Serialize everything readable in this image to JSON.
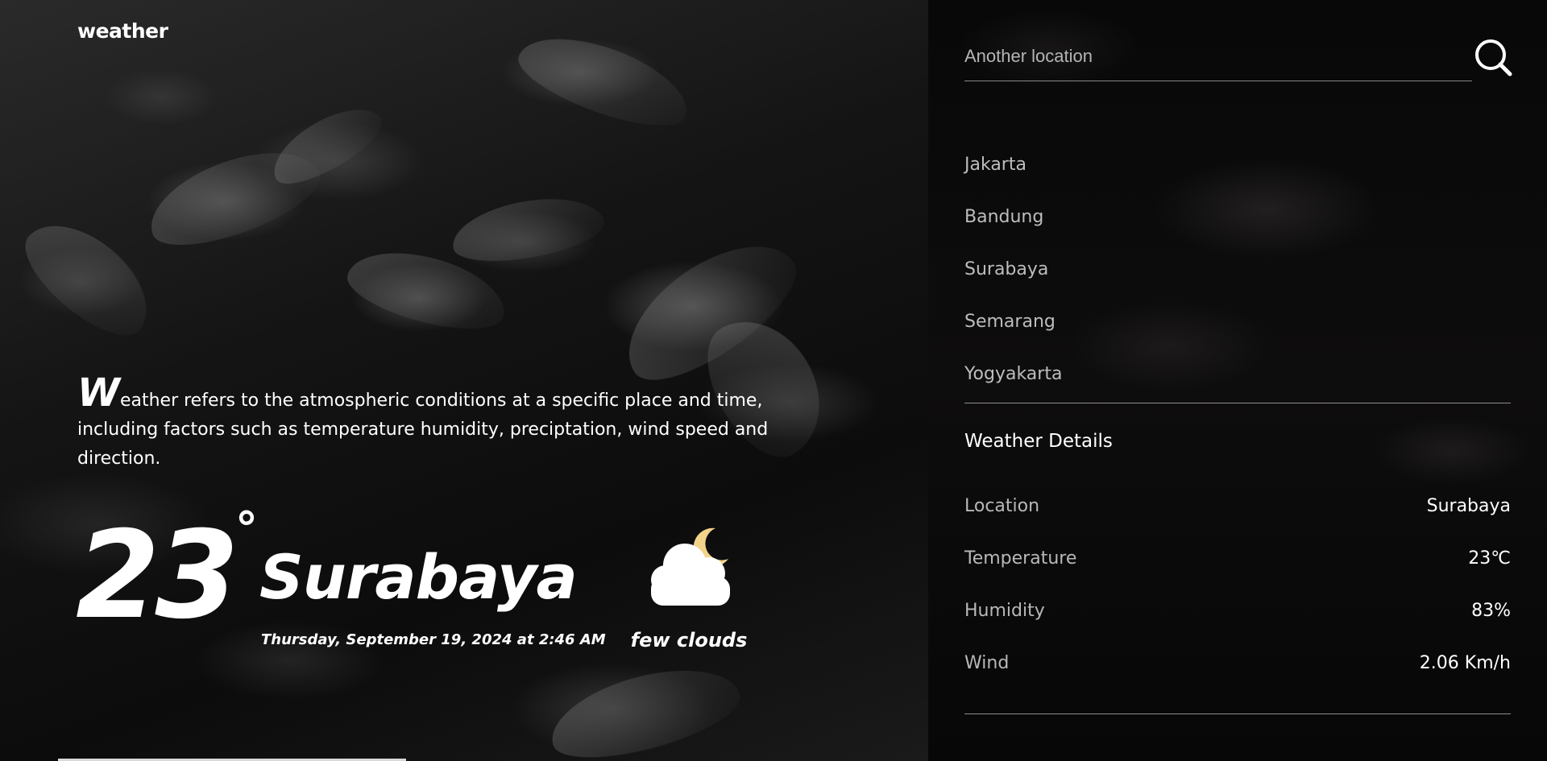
{
  "app": {
    "logo": "weather"
  },
  "intro": {
    "dropcap": "W",
    "text": "eather refers to the atmospheric conditions at a specific place and time, including factors such as temperature humidity, preciptation, wind speed and direction."
  },
  "current": {
    "temperature": "23",
    "degree_symbol": "°",
    "city": "Surabaya",
    "datetime": "Thursday, September 19, 2024 at 2:46 AM",
    "condition": "few clouds",
    "icon": "moon-cloud-icon"
  },
  "search": {
    "placeholder": "Another location",
    "value": "",
    "icon": "search-icon"
  },
  "cities": [
    "Jakarta",
    "Bandung",
    "Surabaya",
    "Semarang",
    "Yogyakarta"
  ],
  "details": {
    "title": "Weather Details",
    "rows": [
      {
        "label": "Location",
        "value": "Surabaya"
      },
      {
        "label": "Temperature",
        "value": "23℃"
      },
      {
        "label": "Humidity",
        "value": "83%"
      },
      {
        "label": "Wind",
        "value": "2.06 Km/h"
      }
    ]
  },
  "colors": {
    "moon": "#f2d38a",
    "cloud": "#ffffff",
    "muted_text": "#bdbdbd",
    "divider": "#8d8d8d",
    "scroll_indicator": "#d9d9d9"
  }
}
